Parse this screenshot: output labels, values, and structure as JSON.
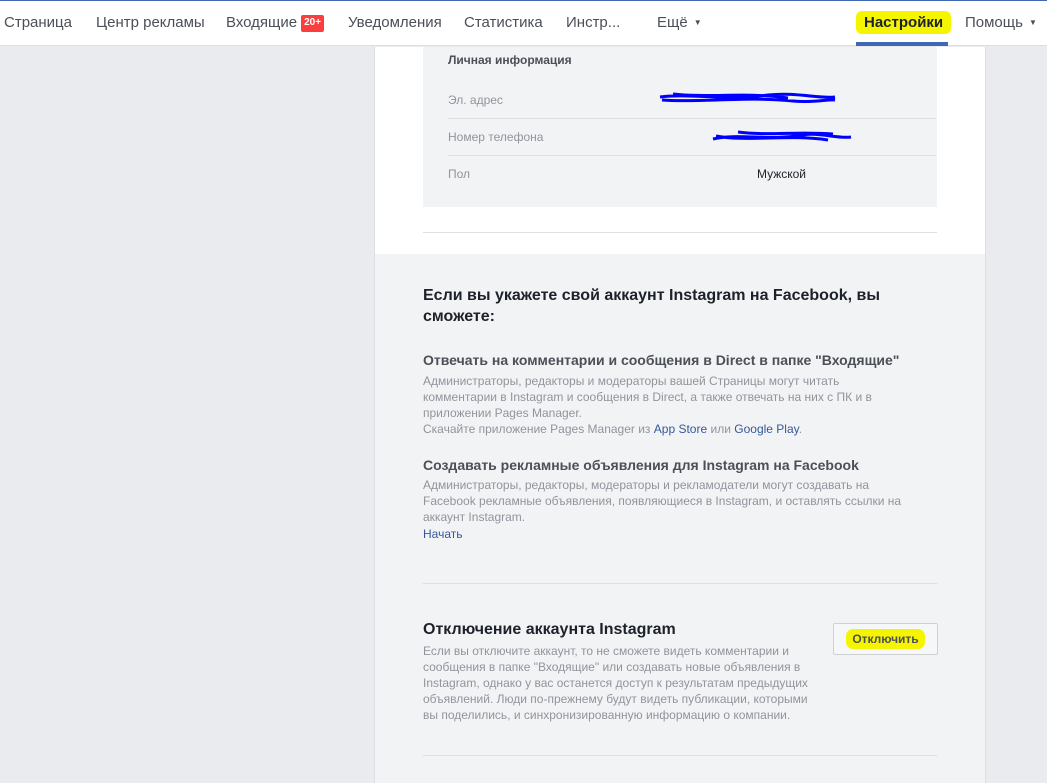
{
  "nav": {
    "items": [
      {
        "label": "Страница"
      },
      {
        "label": "Центр рекламы"
      },
      {
        "label": "Входящие",
        "badge": "20+"
      },
      {
        "label": "Уведомления"
      },
      {
        "label": "Статистика"
      },
      {
        "label": "Инстр..."
      },
      {
        "label": "Ещё"
      },
      {
        "label": "Настройки"
      },
      {
        "label": "Помощь"
      }
    ]
  },
  "personal": {
    "title": "Личная информация",
    "rows": [
      {
        "key": "Эл. адрес",
        "value": ""
      },
      {
        "key": "Номер телефона",
        "value": ""
      },
      {
        "key": "Пол",
        "value": "Мужской"
      }
    ]
  },
  "instagram": {
    "heading": "Если вы укажете свой аккаунт Instagram на Facebook, вы сможете:",
    "feature1_title": "Отвечать на комментарии и сообщения в Direct в папке \"Входящие\"",
    "feature1_desc": "Администраторы, редакторы и модераторы вашей Страницы могут читать комментарии в Instagram и сообщения в Direct, а также отвечать на них с ПК и в приложении Pages Manager.",
    "feature1_download_prefix": "Скачайте приложение Pages Manager из",
    "feature1_app_store": "App Store",
    "feature1_or": "или",
    "feature1_google_play": "Google Play",
    "feature2_title": "Создавать рекламные объявления для Instagram на Facebook",
    "feature2_desc": "Администраторы, редакторы, модераторы и рекламодатели могут создавать на Facebook рекламные объявления, появляющиеся в Instagram, и оставлять ссылки на аккаунт Instagram.",
    "feature2_link": "Начать"
  },
  "disconnect": {
    "title": "Отключение аккаунта Instagram",
    "desc": "Если вы отключите аккаунт, то не сможете видеть комментарии и сообщения в папке \"Входящие\" или создавать новые объявления в Instagram, однако у вас останется доступ к результатам предыдущих объявлений. Люди по-прежнему будут видеть публикации, которыми вы поделились, и синхронизированную информацию о компании.",
    "button": "Отключить"
  },
  "colors": {
    "highlight": "#f5f500",
    "link": "#365899",
    "scribble": "#0000ff",
    "badge": "#fa3e3e"
  }
}
